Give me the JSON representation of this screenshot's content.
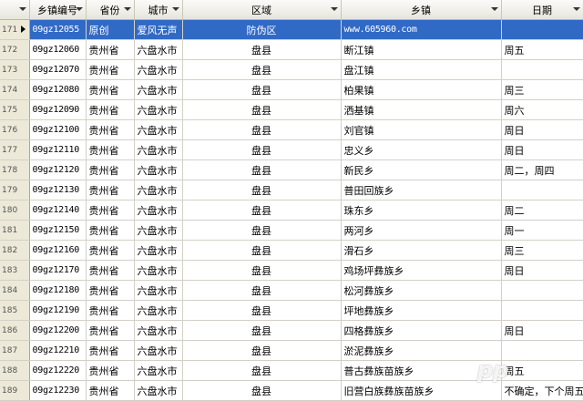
{
  "columns": [
    {
      "label": ""
    },
    {
      "label": "乡镇编号"
    },
    {
      "label": "省份"
    },
    {
      "label": "城市"
    },
    {
      "label": "区域"
    },
    {
      "label": "乡镇"
    },
    {
      "label": "日期"
    }
  ],
  "selected_row": 171,
  "rows": [
    {
      "rn": "171",
      "code": "09gz12055",
      "province": "原创",
      "city": "爱风无声",
      "area": "防伪区",
      "town": "www.605960.com",
      "day": ""
    },
    {
      "rn": "172",
      "code": "09gz12060",
      "province": "贵州省",
      "city": "六盘水市",
      "area": "盘县",
      "town": "断江镇",
      "day": "周五"
    },
    {
      "rn": "173",
      "code": "09gz12070",
      "province": "贵州省",
      "city": "六盘水市",
      "area": "盘县",
      "town": "盘江镇",
      "day": ""
    },
    {
      "rn": "174",
      "code": "09gz12080",
      "province": "贵州省",
      "city": "六盘水市",
      "area": "盘县",
      "town": "柏果镇",
      "day": "周三"
    },
    {
      "rn": "175",
      "code": "09gz12090",
      "province": "贵州省",
      "city": "六盘水市",
      "area": "盘县",
      "town": "洒基镇",
      "day": "周六"
    },
    {
      "rn": "176",
      "code": "09gz12100",
      "province": "贵州省",
      "city": "六盘水市",
      "area": "盘县",
      "town": "刘官镇",
      "day": "周日"
    },
    {
      "rn": "177",
      "code": "09gz12110",
      "province": "贵州省",
      "city": "六盘水市",
      "area": "盘县",
      "town": "忠义乡",
      "day": "周日"
    },
    {
      "rn": "178",
      "code": "09gz12120",
      "province": "贵州省",
      "city": "六盘水市",
      "area": "盘县",
      "town": "新民乡",
      "day": "周二，周四"
    },
    {
      "rn": "179",
      "code": "09gz12130",
      "province": "贵州省",
      "city": "六盘水市",
      "area": "盘县",
      "town": "普田回族乡",
      "day": ""
    },
    {
      "rn": "180",
      "code": "09gz12140",
      "province": "贵州省",
      "city": "六盘水市",
      "area": "盘县",
      "town": "珠东乡",
      "day": "周二"
    },
    {
      "rn": "181",
      "code": "09gz12150",
      "province": "贵州省",
      "city": "六盘水市",
      "area": "盘县",
      "town": "两河乡",
      "day": "周一"
    },
    {
      "rn": "182",
      "code": "09gz12160",
      "province": "贵州省",
      "city": "六盘水市",
      "area": "盘县",
      "town": "滑石乡",
      "day": "周三"
    },
    {
      "rn": "183",
      "code": "09gz12170",
      "province": "贵州省",
      "city": "六盘水市",
      "area": "盘县",
      "town": "鸡场坪彝族乡",
      "day": "周日"
    },
    {
      "rn": "184",
      "code": "09gz12180",
      "province": "贵州省",
      "city": "六盘水市",
      "area": "盘县",
      "town": "松河彝族乡",
      "day": ""
    },
    {
      "rn": "185",
      "code": "09gz12190",
      "province": "贵州省",
      "city": "六盘水市",
      "area": "盘县",
      "town": "坪地彝族乡",
      "day": ""
    },
    {
      "rn": "186",
      "code": "09gz12200",
      "province": "贵州省",
      "city": "六盘水市",
      "area": "盘县",
      "town": "四格彝族乡",
      "day": "周日"
    },
    {
      "rn": "187",
      "code": "09gz12210",
      "province": "贵州省",
      "city": "六盘水市",
      "area": "盘县",
      "town": "淤泥彝族乡",
      "day": ""
    },
    {
      "rn": "188",
      "code": "09gz12220",
      "province": "贵州省",
      "city": "六盘水市",
      "area": "盘县",
      "town": "普古彝族苗族乡",
      "day": "周五"
    },
    {
      "rn": "189",
      "code": "09gz12230",
      "province": "贵州省",
      "city": "六盘水市",
      "area": "盘县",
      "town": "旧营白族彝族苗族乡",
      "day": "不确定，下个周五"
    }
  ],
  "watermark": {
    "logo_text": "pp",
    "caption": "下个周五"
  }
}
